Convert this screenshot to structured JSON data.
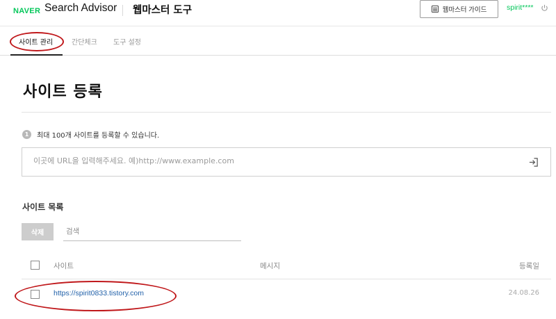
{
  "header": {
    "brand": "NAVER",
    "product": "Search Advisor",
    "tool": "웹마스터 도구",
    "guide_button": "웹마스터 가이드",
    "user": "spirit****",
    "brand_color": "#03c75a"
  },
  "tabs": [
    {
      "label": "사이트 관리",
      "active": true
    },
    {
      "label": "간단체크",
      "active": false
    },
    {
      "label": "도구 설정",
      "active": false
    }
  ],
  "main": {
    "title": "사이트 등록",
    "info_icon_text": "1",
    "info": "최대 100개 사이트를 등록할 수 있습니다.",
    "url_placeholder": "이곳에 URL을 입력해주세요. 예)http://www.example.com"
  },
  "site_list": {
    "title": "사이트 목록",
    "delete_button": "삭제",
    "search_placeholder": "검색",
    "columns": {
      "site": "사이트",
      "message": "메시지",
      "date": "등록일"
    },
    "rows": [
      {
        "site": "https://spirit0833.tistory.com",
        "message": "",
        "date": "24.08.26"
      }
    ]
  },
  "icons": {
    "guide": "book-icon",
    "logout": "power-icon",
    "submit": "login-arrow-icon",
    "info": "info-circle-icon"
  },
  "annotation_color": "#c0181b"
}
